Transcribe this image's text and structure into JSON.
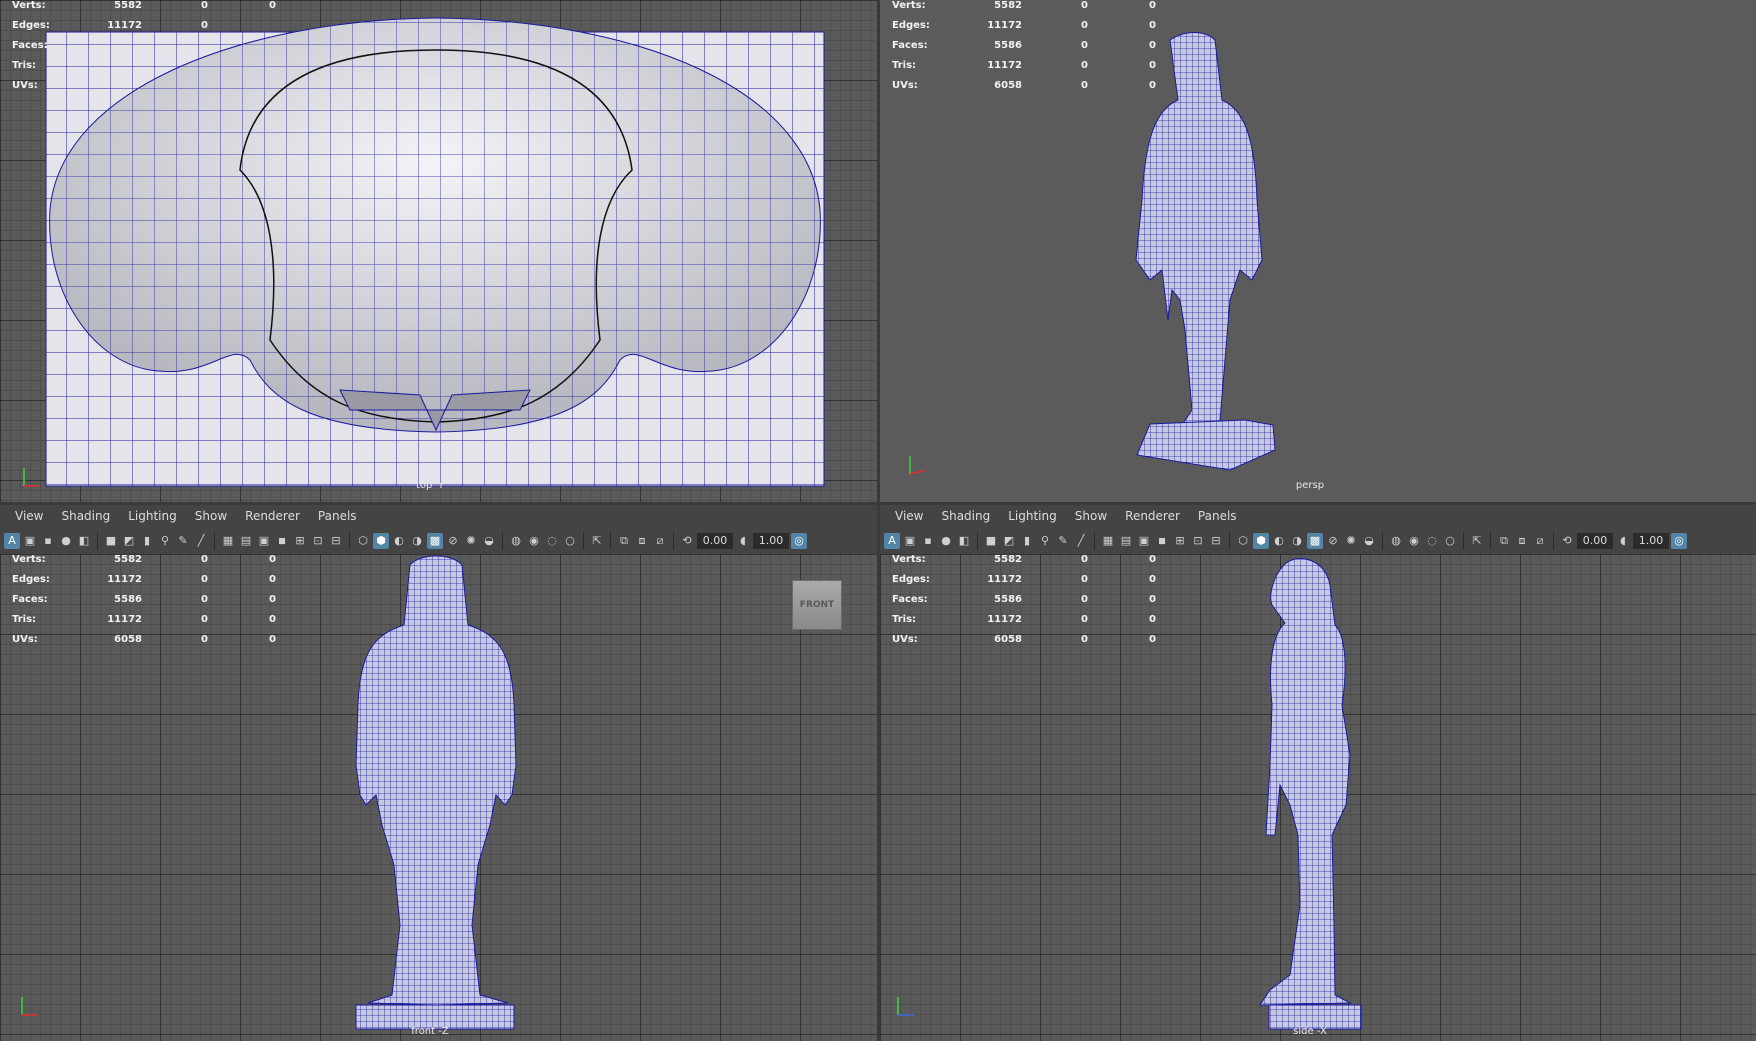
{
  "hud": {
    "labels": {
      "verts": "Verts:",
      "edges": "Edges:",
      "faces": "Faces:",
      "tris": "Tris:",
      "uvs": "UVs:"
    },
    "top": {
      "verts": [
        "5582",
        "0",
        "0"
      ],
      "edges": [
        "11172",
        "0",
        ""
      ],
      "faces": [
        "",
        "",
        ""
      ],
      "tris": [
        "",
        "",
        ""
      ],
      "uvs": [
        "",
        "",
        ""
      ]
    },
    "full": {
      "verts": [
        "5582",
        "0",
        "0"
      ],
      "edges": [
        "11172",
        "0",
        "0"
      ],
      "faces": [
        "5586",
        "0",
        "0"
      ],
      "tris": [
        "11172",
        "0",
        "0"
      ],
      "uvs": [
        "6058",
        "0",
        "0"
      ]
    }
  },
  "menu": [
    "View",
    "Shading",
    "Lighting",
    "Show",
    "Renderer",
    "Panels"
  ],
  "toolbar": {
    "field1": "0.00",
    "field2": "1.00"
  },
  "viewports": {
    "top": {
      "label": "top -Y"
    },
    "persp": {
      "label": "persp"
    },
    "front": {
      "label": "front -Z",
      "viewcube": "FRONT"
    },
    "side": {
      "label": "side -X"
    }
  },
  "colors": {
    "wire": "#1a1a9e",
    "shaded": "#d8d8de",
    "accent": "#5285a6"
  },
  "icons": [
    "select-icon",
    "camera-icon",
    "grid-icon",
    "wireframe-icon",
    "shaded-icon",
    "light-icon",
    "isolate-icon",
    "exposure-icon",
    "gamma-icon"
  ]
}
